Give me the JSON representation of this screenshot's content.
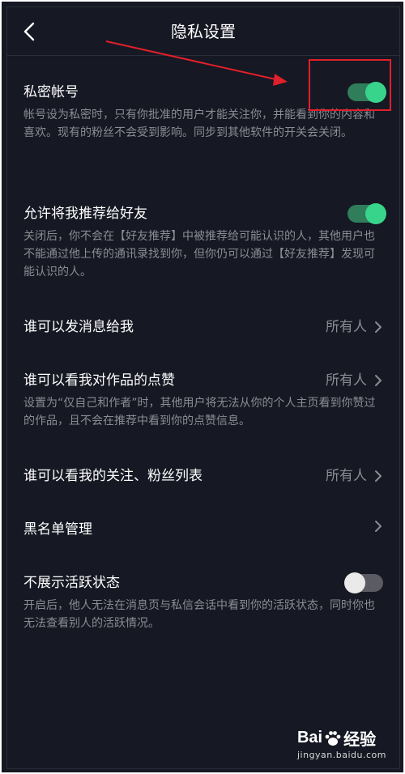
{
  "header": {
    "title": "隐私设置"
  },
  "settings": [
    {
      "title": "私密帐号",
      "desc": "帐号设为私密时，只有你批准的用户才能关注你，并能看到你的内容和喜欢。现有的粉丝不会受到影响。同步到其他软件的开关会关闭。",
      "toggle": "on"
    },
    {
      "title": "允许将我推荐给好友",
      "desc": "关闭后，你不会在【好友推荐】中被推荐给可能认识的人，其他用户也不能通过他上传的通讯录找到你，但你仍可以通过【好友推荐】发现可能认识的人。",
      "toggle": "on"
    },
    {
      "title": "谁可以发消息给我",
      "value": "所有人"
    },
    {
      "title": "谁可以看我对作品的点赞",
      "value": "所有人",
      "desc": "设置为“仅自己和作者”时，其他用户将无法从你的个人主页看到你赞过的作品，且不会在推荐中看到你的点赞信息。"
    },
    {
      "title": "谁可以看我的关注、粉丝列表",
      "value": "所有人"
    },
    {
      "title": "黑名单管理"
    },
    {
      "title": "不展示活跃状态",
      "desc": "开启后，他人无法在消息页与私信会话中看到你的活跃状态，同时你也无法查看别人的活跃情况。",
      "toggle": "off"
    }
  ],
  "watermark": {
    "logo_left": "Bai",
    "logo_right": "经验",
    "url": "jingyan.baidu.com"
  },
  "colors": {
    "background": "#161823",
    "toggle_on_track": "#2f7d5b",
    "toggle_on_knob": "#38d48b",
    "toggle_off_track": "#5a5b63",
    "annotation": "#e0202a"
  }
}
